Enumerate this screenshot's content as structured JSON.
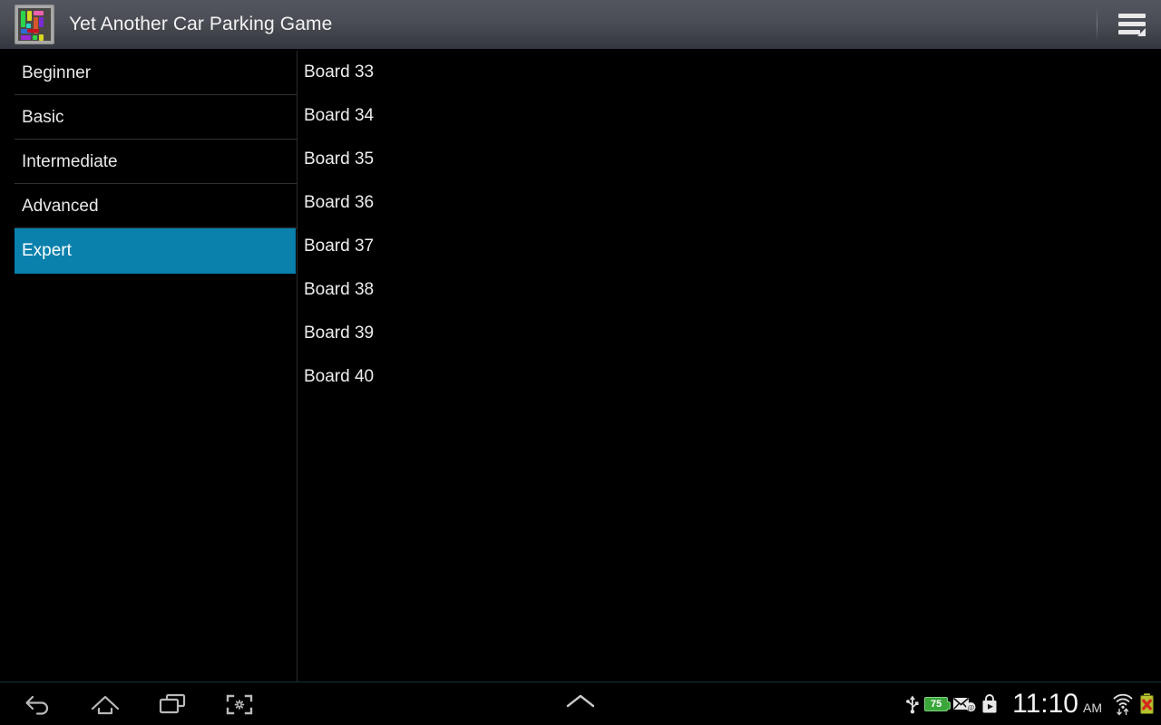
{
  "titlebar": {
    "app_title": "Yet Another Car Parking Game",
    "app_icon_name": "car-parking-puzzle-icon",
    "menu_label": "Menu",
    "menu_icon_name": "hamburger-overflow-menu-icon"
  },
  "sidebar": {
    "items": [
      {
        "label": "Beginner",
        "selected": false
      },
      {
        "label": "Basic",
        "selected": false
      },
      {
        "label": "Intermediate",
        "selected": false
      },
      {
        "label": "Advanced",
        "selected": false
      },
      {
        "label": "Expert",
        "selected": true
      }
    ],
    "selected_color": "#0a80ad"
  },
  "boardlist": {
    "items": [
      {
        "label": "Board 33"
      },
      {
        "label": "Board 34"
      },
      {
        "label": "Board 35"
      },
      {
        "label": "Board 36"
      },
      {
        "label": "Board 37"
      },
      {
        "label": "Board 38"
      },
      {
        "label": "Board 39"
      },
      {
        "label": "Board 40"
      }
    ]
  },
  "systembar": {
    "nav": [
      {
        "name": "back-icon",
        "label": "Back"
      },
      {
        "name": "home-icon",
        "label": "Home"
      },
      {
        "name": "recent-apps-icon",
        "label": "Recent apps"
      },
      {
        "name": "screenshot-icon",
        "label": "Screenshot"
      }
    ],
    "expand_icon": "chevron-up-icon",
    "status_icons": [
      {
        "name": "usb-icon",
        "label": "USB connected"
      },
      {
        "name": "battery-percent-icon",
        "label": "75"
      },
      {
        "name": "email-icon",
        "label": "New email"
      },
      {
        "name": "play-store-icon",
        "label": "Play Store"
      },
      {
        "name": "wifi-icon",
        "label": "Wi-Fi"
      },
      {
        "name": "battery-error-icon",
        "label": "Battery error"
      }
    ],
    "battery_level": "75",
    "clock_time": "11:10",
    "clock_ampm": "AM"
  },
  "icon_colors": {
    "battery_green": "#3aa63a",
    "battery_error_body": "#b6c22e",
    "battery_error_x": "#d32b1e",
    "nav_icon": "#b9b9b9",
    "status_icon": "#e6e6e6"
  }
}
